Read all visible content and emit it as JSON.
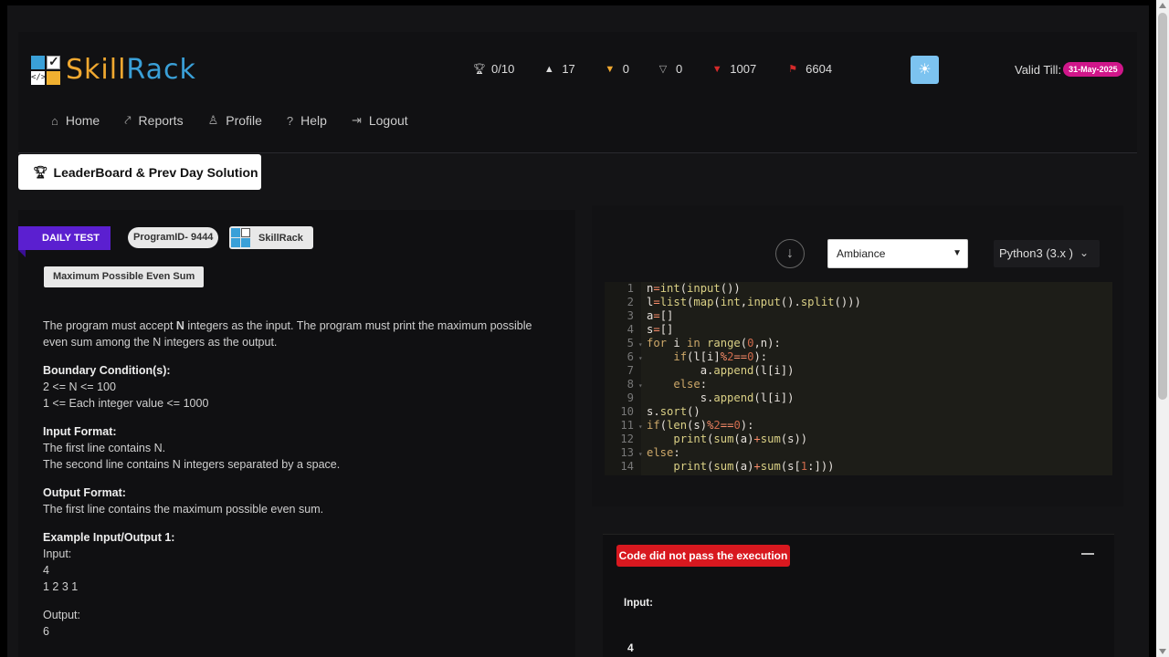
{
  "brand": {
    "name_part1": "Skill",
    "name_part2": "Rack",
    "logo_glyph": "</>"
  },
  "stats": [
    {
      "icon": "trophy-icon",
      "value": "0/10"
    },
    {
      "icon": "graduation-cap-icon",
      "value": "17"
    },
    {
      "icon": "shield-gold-icon",
      "value": "0"
    },
    {
      "icon": "shield-gray-icon",
      "value": "0"
    },
    {
      "icon": "shield-red-icon",
      "value": "1007"
    },
    {
      "icon": "flag-icon",
      "value": "6604"
    }
  ],
  "valid_till": {
    "label": "Valid Till:",
    "date": "31-May-2025"
  },
  "nav": [
    {
      "label": "Home"
    },
    {
      "label": "Reports"
    },
    {
      "label": "Profile"
    },
    {
      "label": "Help"
    },
    {
      "label": "Logout"
    }
  ],
  "leaderboard_button": "LeaderBoard & Prev Day Solution",
  "problem": {
    "tag": "DAILY TEST",
    "program_id": "ProgramID- 9444",
    "source": "SkillRack",
    "title": "Maximum Possible Even Sum",
    "intro_a": "The program must accept ",
    "intro_bold": "N",
    "intro_b": " integers as the input. The program must print the maximum possible even sum among the N integers as the output.",
    "boundary_heading": "Boundary Condition(s):",
    "boundary_1": "2 <= N <= 100",
    "boundary_2": "1 <= Each integer value <= 1000",
    "input_heading": "Input Format:",
    "input_1": "The first line contains N.",
    "input_2": "The second line contains N integers separated by a space.",
    "output_heading": "Output Format:",
    "output_1": "The first line contains the maximum possible even sum.",
    "example_heading": "Example Input/Output 1:",
    "example_input_label": "Input:",
    "example_input_1": "4",
    "example_input_2": "1 2 3 1",
    "example_output_label": "Output:",
    "example_output_1": "6"
  },
  "editor": {
    "theme": "Ambiance",
    "language": "Python3 (3.x )",
    "line_numbers": [
      "1",
      "2",
      "3",
      "4",
      "5",
      "6",
      "7",
      "8",
      "9",
      "10",
      "11",
      "12",
      "13",
      "14"
    ],
    "code_lines": [
      "n=int(input())",
      "l=list(map(int,input().split()))",
      "a=[]",
      "s=[]",
      "for i in range(0,n):",
      "    if(l[i]%2==0):",
      "        a.append(l[i])",
      "    else:",
      "        s.append(l[i])",
      "s.sort()",
      "if(len(s)%2==0):",
      "    print(sum(a)+sum(s))",
      "else:",
      "    print(sum(a)+sum(s[1:]))"
    ]
  },
  "result": {
    "status": "Code did not pass the execution",
    "input_label": "Input:",
    "input_value": "4"
  },
  "colors": {
    "accent_blue": "#3aa0d8",
    "accent_orange": "#f0a830",
    "badge_pink": "#d0168a",
    "ribbon_purple": "#5b1fd0",
    "error_red": "#d8181f"
  }
}
